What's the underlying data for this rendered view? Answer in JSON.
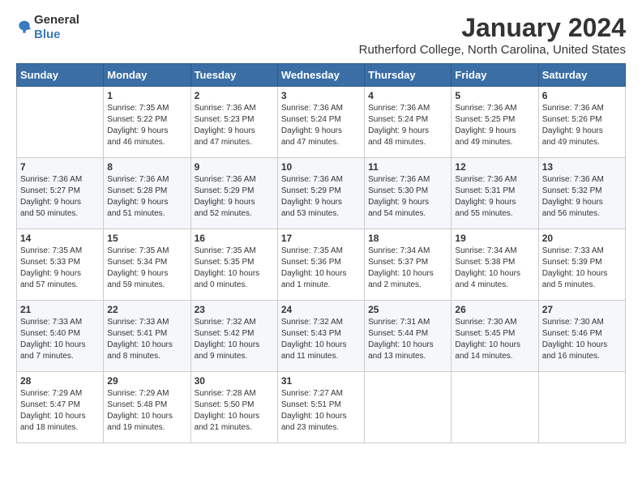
{
  "logo": {
    "general": "General",
    "blue": "Blue"
  },
  "title": "January 2024",
  "subtitle": "Rutherford College, North Carolina, United States",
  "calendar": {
    "headers": [
      "Sunday",
      "Monday",
      "Tuesday",
      "Wednesday",
      "Thursday",
      "Friday",
      "Saturday"
    ],
    "rows": [
      [
        {
          "day": "",
          "info": ""
        },
        {
          "day": "1",
          "info": "Sunrise: 7:35 AM\nSunset: 5:22 PM\nDaylight: 9 hours\nand 46 minutes."
        },
        {
          "day": "2",
          "info": "Sunrise: 7:36 AM\nSunset: 5:23 PM\nDaylight: 9 hours\nand 47 minutes."
        },
        {
          "day": "3",
          "info": "Sunrise: 7:36 AM\nSunset: 5:24 PM\nDaylight: 9 hours\nand 47 minutes."
        },
        {
          "day": "4",
          "info": "Sunrise: 7:36 AM\nSunset: 5:24 PM\nDaylight: 9 hours\nand 48 minutes."
        },
        {
          "day": "5",
          "info": "Sunrise: 7:36 AM\nSunset: 5:25 PM\nDaylight: 9 hours\nand 49 minutes."
        },
        {
          "day": "6",
          "info": "Sunrise: 7:36 AM\nSunset: 5:26 PM\nDaylight: 9 hours\nand 49 minutes."
        }
      ],
      [
        {
          "day": "7",
          "info": "Sunrise: 7:36 AM\nSunset: 5:27 PM\nDaylight: 9 hours\nand 50 minutes."
        },
        {
          "day": "8",
          "info": "Sunrise: 7:36 AM\nSunset: 5:28 PM\nDaylight: 9 hours\nand 51 minutes."
        },
        {
          "day": "9",
          "info": "Sunrise: 7:36 AM\nSunset: 5:29 PM\nDaylight: 9 hours\nand 52 minutes."
        },
        {
          "day": "10",
          "info": "Sunrise: 7:36 AM\nSunset: 5:29 PM\nDaylight: 9 hours\nand 53 minutes."
        },
        {
          "day": "11",
          "info": "Sunrise: 7:36 AM\nSunset: 5:30 PM\nDaylight: 9 hours\nand 54 minutes."
        },
        {
          "day": "12",
          "info": "Sunrise: 7:36 AM\nSunset: 5:31 PM\nDaylight: 9 hours\nand 55 minutes."
        },
        {
          "day": "13",
          "info": "Sunrise: 7:36 AM\nSunset: 5:32 PM\nDaylight: 9 hours\nand 56 minutes."
        }
      ],
      [
        {
          "day": "14",
          "info": "Sunrise: 7:35 AM\nSunset: 5:33 PM\nDaylight: 9 hours\nand 57 minutes."
        },
        {
          "day": "15",
          "info": "Sunrise: 7:35 AM\nSunset: 5:34 PM\nDaylight: 9 hours\nand 59 minutes."
        },
        {
          "day": "16",
          "info": "Sunrise: 7:35 AM\nSunset: 5:35 PM\nDaylight: 10 hours\nand 0 minutes."
        },
        {
          "day": "17",
          "info": "Sunrise: 7:35 AM\nSunset: 5:36 PM\nDaylight: 10 hours\nand 1 minute."
        },
        {
          "day": "18",
          "info": "Sunrise: 7:34 AM\nSunset: 5:37 PM\nDaylight: 10 hours\nand 2 minutes."
        },
        {
          "day": "19",
          "info": "Sunrise: 7:34 AM\nSunset: 5:38 PM\nDaylight: 10 hours\nand 4 minutes."
        },
        {
          "day": "20",
          "info": "Sunrise: 7:33 AM\nSunset: 5:39 PM\nDaylight: 10 hours\nand 5 minutes."
        }
      ],
      [
        {
          "day": "21",
          "info": "Sunrise: 7:33 AM\nSunset: 5:40 PM\nDaylight: 10 hours\nand 7 minutes."
        },
        {
          "day": "22",
          "info": "Sunrise: 7:33 AM\nSunset: 5:41 PM\nDaylight: 10 hours\nand 8 minutes."
        },
        {
          "day": "23",
          "info": "Sunrise: 7:32 AM\nSunset: 5:42 PM\nDaylight: 10 hours\nand 9 minutes."
        },
        {
          "day": "24",
          "info": "Sunrise: 7:32 AM\nSunset: 5:43 PM\nDaylight: 10 hours\nand 11 minutes."
        },
        {
          "day": "25",
          "info": "Sunrise: 7:31 AM\nSunset: 5:44 PM\nDaylight: 10 hours\nand 13 minutes."
        },
        {
          "day": "26",
          "info": "Sunrise: 7:30 AM\nSunset: 5:45 PM\nDaylight: 10 hours\nand 14 minutes."
        },
        {
          "day": "27",
          "info": "Sunrise: 7:30 AM\nSunset: 5:46 PM\nDaylight: 10 hours\nand 16 minutes."
        }
      ],
      [
        {
          "day": "28",
          "info": "Sunrise: 7:29 AM\nSunset: 5:47 PM\nDaylight: 10 hours\nand 18 minutes."
        },
        {
          "day": "29",
          "info": "Sunrise: 7:29 AM\nSunset: 5:48 PM\nDaylight: 10 hours\nand 19 minutes."
        },
        {
          "day": "30",
          "info": "Sunrise: 7:28 AM\nSunset: 5:50 PM\nDaylight: 10 hours\nand 21 minutes."
        },
        {
          "day": "31",
          "info": "Sunrise: 7:27 AM\nSunset: 5:51 PM\nDaylight: 10 hours\nand 23 minutes."
        },
        {
          "day": "",
          "info": ""
        },
        {
          "day": "",
          "info": ""
        },
        {
          "day": "",
          "info": ""
        }
      ]
    ]
  }
}
